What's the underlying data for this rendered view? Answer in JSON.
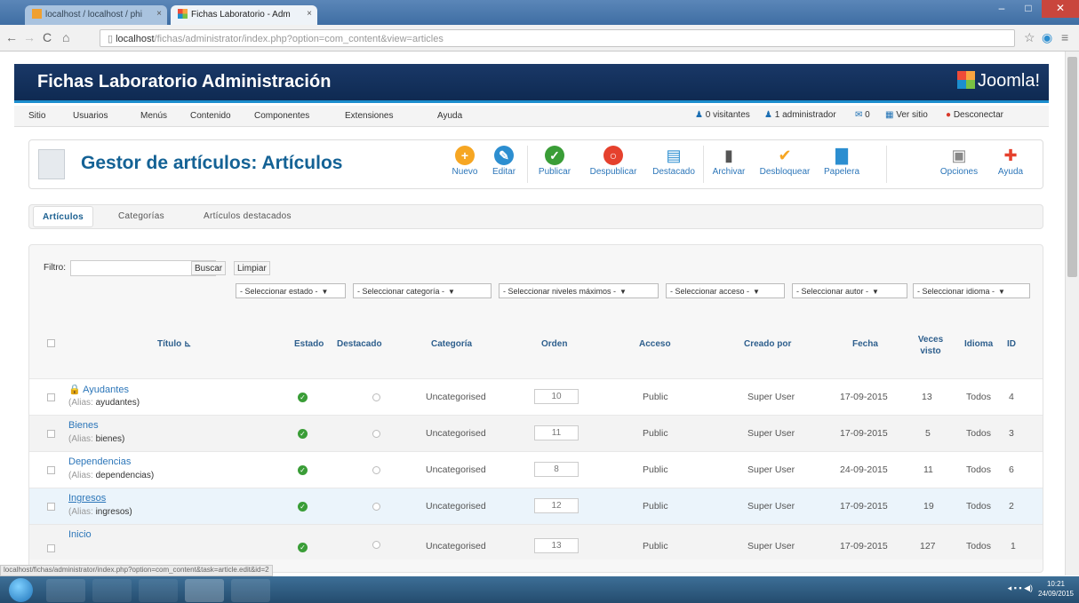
{
  "browser": {
    "tabs": [
      {
        "label": "localhost / localhost / phi"
      },
      {
        "label": "Fichas Laboratorio - Adm"
      }
    ],
    "url_host": "localhost",
    "url_path": "/fichas/administrator/index.php?option=com_content&view=articles",
    "status_link": "localhost/fichas/administrator/index.php?option=com_content&task=article.edit&id=2"
  },
  "header": {
    "site_title": "Fichas Laboratorio Administración",
    "brand": "Joomla!"
  },
  "menu": {
    "items": [
      "Sitio",
      "Usuarios",
      "Menús",
      "Contenido",
      "Componentes",
      "Extensiones",
      "Ayuda"
    ],
    "status": {
      "visitors": "0 visitantes",
      "admins": "1 administrador",
      "messages": "0",
      "view_site": "Ver sitio",
      "logout": "Desconectar"
    }
  },
  "toolbar": {
    "page_title": "Gestor de artículos: Artículos",
    "buttons": [
      {
        "label": "Nuevo",
        "icon": "plus-icon",
        "color": "#f6a623"
      },
      {
        "label": "Editar",
        "icon": "pencil-icon",
        "color": "#2c8ed0"
      },
      {
        "label": "Publicar",
        "icon": "check-circle-icon",
        "color": "#3a9d37"
      },
      {
        "label": "Despublicar",
        "icon": "unpublish-icon",
        "color": "#e5412d"
      },
      {
        "label": "Destacado",
        "icon": "featured-icon",
        "color": "#2c8ed0"
      },
      {
        "label": "Archivar",
        "icon": "archive-icon",
        "color": "#555555"
      },
      {
        "label": "Desbloquear",
        "icon": "checkin-icon",
        "color": "#f6a623"
      },
      {
        "label": "Papelera",
        "icon": "trash-icon",
        "color": "#2c8ed0"
      },
      {
        "label": "Opciones",
        "icon": "options-icon",
        "color": "#888888"
      },
      {
        "label": "Ayuda",
        "icon": "help-icon",
        "color": "#e5412d"
      }
    ]
  },
  "subtabs": [
    "Artículos",
    "Categorías",
    "Artículos destacados"
  ],
  "filter": {
    "label": "Filtro:",
    "search_value": "",
    "search_button": "Buscar",
    "clear_button": "Limpiar",
    "selects": [
      "- Seleccionar estado -",
      "- Seleccionar categoría -",
      "- Seleccionar niveles máximos -",
      "- Seleccionar acceso -",
      "- Seleccionar autor -",
      "- Seleccionar idioma -"
    ]
  },
  "table": {
    "columns": [
      "Título",
      "Estado",
      "Destacado",
      "Categoría",
      "Orden",
      "Acceso",
      "Creado por",
      "Fecha",
      "Veces visto",
      "Idioma",
      "ID"
    ],
    "rows": [
      {
        "title": "Ayudantes",
        "alias": "ayudantes",
        "locked": true,
        "category": "Uncategorised",
        "order": "10",
        "access": "Public",
        "author": "Super User",
        "date": "17-09-2015",
        "hits": "13",
        "language": "Todos",
        "id": "4"
      },
      {
        "title": "Bienes",
        "alias": "bienes",
        "locked": false,
        "category": "Uncategorised",
        "order": "11",
        "access": "Public",
        "author": "Super User",
        "date": "17-09-2015",
        "hits": "5",
        "language": "Todos",
        "id": "3"
      },
      {
        "title": "Dependencias",
        "alias": "dependencias",
        "locked": false,
        "category": "Uncategorised",
        "order": "8",
        "access": "Public",
        "author": "Super User",
        "date": "24-09-2015",
        "hits": "11",
        "language": "Todos",
        "id": "6"
      },
      {
        "title": "Ingresos",
        "alias": "ingresos",
        "locked": false,
        "category": "Uncategorised",
        "order": "12",
        "access": "Public",
        "author": "Super User",
        "date": "17-09-2015",
        "hits": "19",
        "language": "Todos",
        "id": "2"
      },
      {
        "title": "Inicio",
        "alias": "",
        "locked": false,
        "category": "Uncategorised",
        "order": "13",
        "access": "Public",
        "author": "Super User",
        "date": "17-09-2015",
        "hits": "127",
        "language": "Todos",
        "id": "1"
      }
    ],
    "alias_label": "(Alias:"
  },
  "taskbar": {
    "time": "10:21",
    "date": "24/09/2015"
  }
}
